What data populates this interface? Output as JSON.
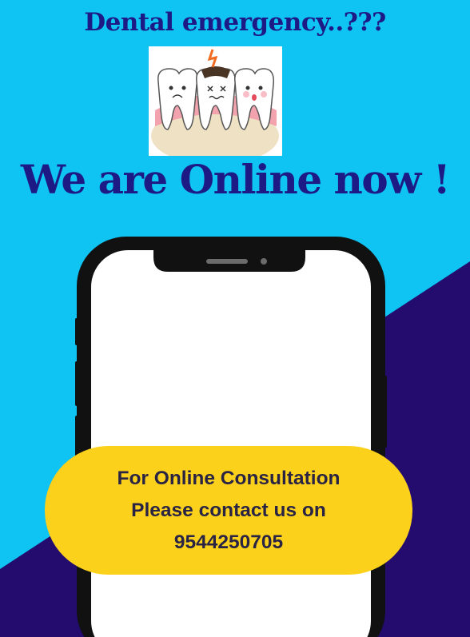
{
  "header": {
    "question": "Dental emergency..???",
    "headline": "We are Online now !"
  },
  "illustration": {
    "icon": "sad-teeth-icon",
    "description_icon": "toothache-teeth-icon"
  },
  "callout": {
    "line1": "For Online Consultation",
    "line2": "Please contact us on",
    "phone": "9544250705"
  },
  "colors": {
    "background_light": "#0fc3f2",
    "background_dark": "#240b6e",
    "heading": "#1e1a85",
    "pill": "#fcd11c",
    "phone_frame": "#111111"
  }
}
